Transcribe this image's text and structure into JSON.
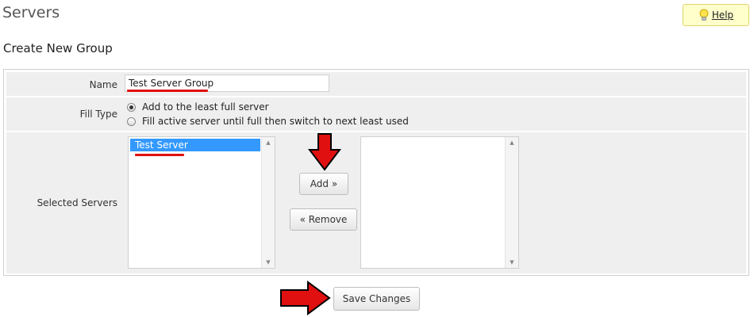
{
  "page": {
    "title": "Servers"
  },
  "help": {
    "label": "Help",
    "icon": "lightbulb-icon"
  },
  "section": {
    "title": "Create New Group"
  },
  "form": {
    "name": {
      "label": "Name",
      "value": "Test Server Group"
    },
    "fill_type": {
      "label": "Fill Type",
      "options": [
        {
          "label": "Add to the least full server",
          "selected": true
        },
        {
          "label": "Fill active server until full then switch to next least used",
          "selected": false
        }
      ]
    },
    "selected_servers": {
      "label": "Selected Servers",
      "available": [
        "Test Server"
      ],
      "selected": []
    },
    "add_label": "Add »",
    "remove_label": "« Remove",
    "save_label": "Save Changes"
  },
  "colors": {
    "highlight_underline": "#e01010",
    "annotation_arrow": "#e01010",
    "list_selection": "#3399ff",
    "help_background": "#ffffcc"
  }
}
